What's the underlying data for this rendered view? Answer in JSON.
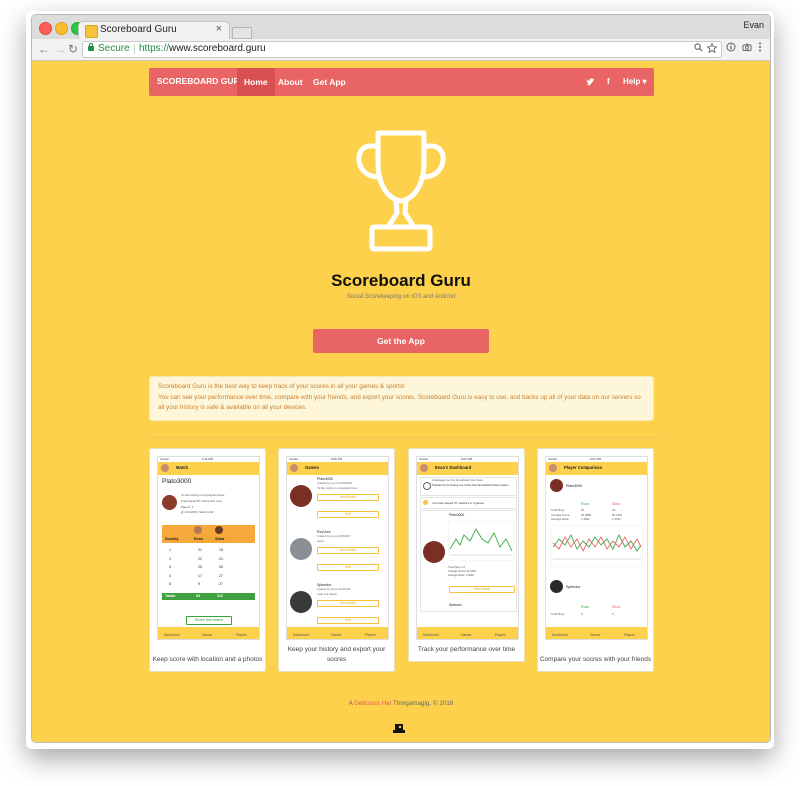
{
  "browser": {
    "tab_title": "Scoreboard Guru",
    "tab_close": "×",
    "user_name": "Evan",
    "secure_label": "Secure",
    "url_protocol": "https://",
    "url_host": "www.scoreboard.guru",
    "nav_back": "←",
    "nav_forward": "→",
    "nav_reload": "↻"
  },
  "navbar": {
    "brand": "SCOREBOARD GURU",
    "links": [
      "Home",
      "About",
      "Get App"
    ],
    "active_index": 0,
    "twitter_icon": "twitter-icon",
    "facebook_glyph": "f",
    "help_label": "Help ▾"
  },
  "hero": {
    "icon": "trophy-icon",
    "title": "Scoreboard Guru",
    "subtitle": "Social Scorekeeping on iOS and Andriod",
    "cta_label": "Get the App"
  },
  "info": {
    "line1": "Scoreboard Guru is the best way to keep track of your scores in all your games & sports!",
    "line2": "You can see your performance over time, compare with your friends, and export your scores. Scoreboard Guru is easy to use, and backs up all of your data on our servers so all your history is safe & available on all your devices."
  },
  "cards": [
    {
      "caption": "Keep score with location and a photos",
      "screen": {
        "header": "Match",
        "status_carrier": "Carrier",
        "status_time": "6:11 PM",
        "match_name": "Plato3000",
        "match_desc": "It's like cutting in a dystopian future",
        "match_meta": "Total played 50 / 100 points once",
        "match_meta2": "Players: 2",
        "match_date": "@ 2/21/2018 | Valid 11 AM",
        "table_header": [
          "Society",
          "Evan",
          "Stina"
        ],
        "rows": [
          [
            "1",
            "21",
            "15"
          ],
          [
            "2",
            "22",
            "21"
          ],
          [
            "3",
            "25",
            "26"
          ],
          [
            "4",
            "17",
            "27"
          ],
          [
            "5",
            "9",
            "27"
          ]
        ],
        "totals": [
          "Totals",
          "94",
          "115"
        ],
        "share": "Share this match",
        "tabbar": [
          "Dashboard",
          "Games",
          "Players"
        ]
      }
    },
    {
      "caption": "Keep your history and export your socres",
      "screen": {
        "header": "Games",
        "status_carrier": "Carrier",
        "status_time": "6:06 PM",
        "games": [
          {
            "name": "Plato3000",
            "by": "Created by you on 12/22/2016",
            "desc": "It's like cutting in a dystopian future",
            "btn": "New Match",
            "edit": "Edit"
          },
          {
            "name": "Red Ace",
            "by": "Created by you on 1/05/2017",
            "desc": "Game",
            "btn": "New Match",
            "edit": "Edit"
          },
          {
            "name": "Splendor",
            "by": "Created by you on 2/21/2016",
            "desc": "Color and beauty",
            "btn": "New Match",
            "edit": "Edit"
          }
        ],
        "tabbar": [
          "Dashboard",
          "Games",
          "Players"
        ]
      }
    },
    {
      "caption": "Track your performance over time",
      "screen": {
        "header": "Evan's Dashboard",
        "status_carrier": "Carrier",
        "status_time": "6:07 PM",
        "message_from": "A Message from the Scoreboard Guru Team",
        "message_text": "Thanks for for being one of the first Scoreboard Guru users!",
        "played_note": "You have played 57 matches in 6 games.",
        "game1": "Plato3000",
        "stats": [
          "Total Plays: 13",
          "Average Score: 92.1000",
          "Average Rank: 1.3692"
        ],
        "view_btn": "View Match",
        "game2": "Splendor",
        "tabbar": [
          "Dashboard",
          "Games",
          "Players"
        ]
      }
    },
    {
      "caption": "Compare your socres with your friends",
      "screen": {
        "header": "Player Comparison",
        "status_carrier": "Carrier",
        "status_time": "6:07 PM",
        "game1": "Plato3000",
        "players": [
          "Evan",
          "Stina"
        ],
        "stat_rows": [
          [
            "Total Plays",
            "23",
            "23"
          ],
          [
            "Average Score",
            "92.2889",
            "86.1304"
          ],
          [
            "Average Rank",
            "1.3682",
            "1.4782"
          ]
        ],
        "game2": "Splendor",
        "g2_rows": [
          [
            "Total Plays",
            "6",
            "6"
          ]
        ],
        "tabbar": [
          "Dashboard",
          "Games",
          "Players"
        ]
      }
    }
  ],
  "footer": {
    "prefix": "A ",
    "hat": "Delicious Hat",
    "suffix": " Thingamagig, © 2018"
  },
  "colors": {
    "page_bg": "#fdd14c",
    "accent": "#e96565",
    "info_bg": "#fdf6d8",
    "info_text": "#c97f31"
  }
}
